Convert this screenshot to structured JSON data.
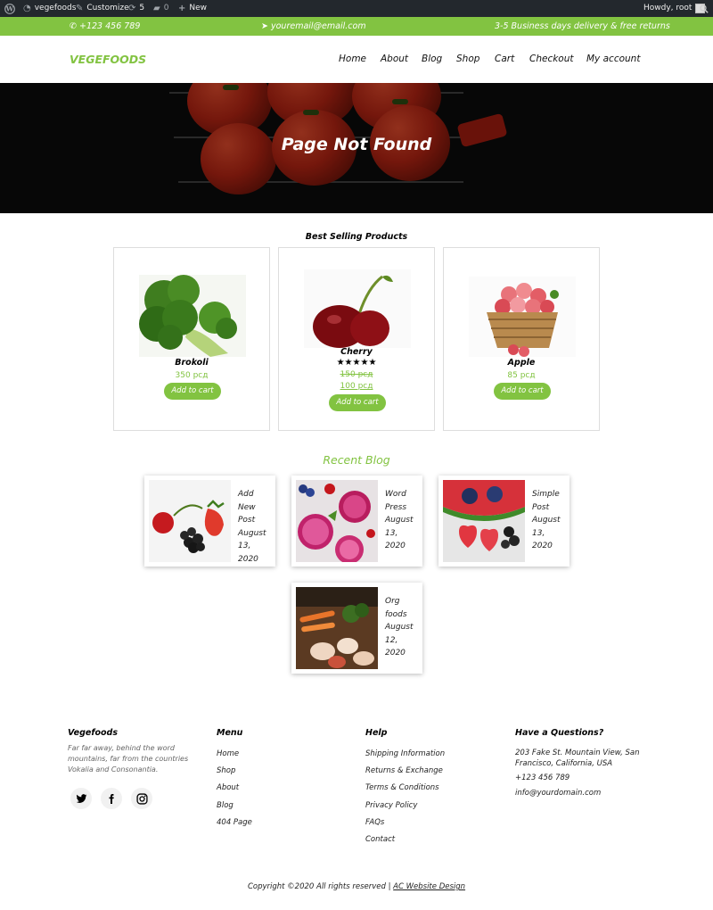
{
  "admin_bar": {
    "site_name": "vegefoods",
    "customize": "Customize",
    "updates_count": "5",
    "comments_count": "0",
    "new_label": "New",
    "greeting": "Howdy, root"
  },
  "top_bar": {
    "phone": "+123 456 789",
    "email": "youremail@email.com",
    "delivery": "3-5 Business days delivery & free returns"
  },
  "nav": {
    "brand": "VEGEFOODS",
    "items": [
      "Home",
      "About",
      "Blog",
      "Shop",
      "Cart",
      "Checkout",
      "My account"
    ]
  },
  "hero": {
    "title": "Page Not Found"
  },
  "products_section": {
    "title": "Best Selling Products",
    "add_to_cart": "Add to cart",
    "items": [
      {
        "name": "Brokoli",
        "price": "350 рсд"
      },
      {
        "name": "Cherry",
        "rating": 5,
        "stars": "★★★★★",
        "old_price": "150 рсд",
        "price": "100 рсд"
      },
      {
        "name": "Apple",
        "price": "85 рсд"
      }
    ]
  },
  "blog_section": {
    "title": "Recent Blog",
    "posts": [
      {
        "title": "Add New Post",
        "date": "August 13, 2020"
      },
      {
        "title": "Word Press",
        "date": "August 13, 2020"
      },
      {
        "title": "Simple Post",
        "date": "August 13, 2020"
      },
      {
        "title": "Org foods",
        "date": "August 12, 2020"
      }
    ]
  },
  "footer": {
    "about": {
      "heading": "Vegefoods",
      "text": "Far far away, behind the word mountains, far from the countries Vokalia and Consonantia."
    },
    "menu": {
      "heading": "Menu",
      "links": [
        "Home",
        "Shop",
        "About",
        "Blog",
        "404 Page"
      ]
    },
    "help": {
      "heading": "Help",
      "links": [
        "Shipping Information",
        "Returns & Exchange",
        "Terms & Conditions",
        "Privacy Policy",
        "FAQs",
        "Contact"
      ]
    },
    "contact": {
      "heading": "Have a Questions?",
      "address": "203 Fake St. Mountain View, San Francisco, California, USA",
      "phone": "+123 456 789",
      "email": "info@yourdomain.com"
    },
    "social": [
      "twitter-icon",
      "facebook-icon",
      "instagram-icon"
    ],
    "copyright_text": "Copyright ©2020 All rights reserved | ",
    "copyright_link": "AC Website Design"
  },
  "colors": {
    "accent": "#82c341",
    "admin_bar": "#23282d",
    "hero_bg": "#0b0b0b"
  }
}
